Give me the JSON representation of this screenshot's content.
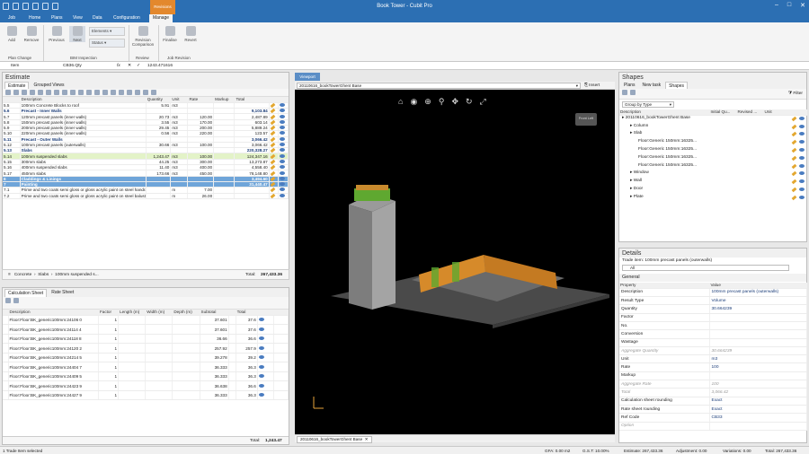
{
  "window": {
    "title": "Book Tower - Cubit Pro",
    "context_tab": "Revisions"
  },
  "menu": [
    "Job",
    "Home",
    "Plans",
    "View",
    "Data",
    "Configuration",
    "Manage"
  ],
  "ribbon": {
    "buttons": [
      {
        "label": "Add",
        "id": "add"
      },
      {
        "label": "Remove",
        "id": "remove"
      },
      {
        "label": "Previous",
        "id": "previous"
      },
      {
        "label": "Next",
        "id": "next"
      },
      {
        "label": "Revision Comparison",
        "id": "revcomp"
      },
      {
        "label": "Finalise",
        "id": "finalise"
      },
      {
        "label": "Revert",
        "id": "revert"
      }
    ],
    "small": {
      "elements": "Elements",
      "status": "Status"
    },
    "groups": [
      "Plan Change",
      "BIM Inspection",
      "Review",
      "Job Revision"
    ]
  },
  "formula_bar": {
    "item": "Item",
    "code": "CB36.Qty",
    "fx": "fx",
    "value": "1243.471616"
  },
  "estimate": {
    "title": "Estimate",
    "tabs": [
      "Estimate",
      "Grouped Views"
    ],
    "columns": [
      "Description",
      "Quantity",
      "Unit",
      "Rate",
      "Markup",
      "Total"
    ],
    "rows": [
      {
        "no": "5.5",
        "desc": "100mm Concrete Blocks to roof",
        "qty": "5.91",
        "unit": "m3",
        "rate": "",
        "total": "",
        "style": ""
      },
      {
        "no": "5.6",
        "desc": "Precast - Inner Walls",
        "qty": "",
        "unit": "",
        "rate": "",
        "total": "9,103.84",
        "style": "bold"
      },
      {
        "no": "5.7",
        "desc": "120mm precast panels (inner walls)",
        "qty": "20.73",
        "unit": "m3",
        "rate": "120.00",
        "total": "2,487.89",
        "style": ""
      },
      {
        "no": "5.8",
        "desc": "150mm precast panels (inner walls)",
        "qty": "3.55",
        "unit": "m3",
        "rate": "170.00",
        "total": "603.14",
        "style": ""
      },
      {
        "no": "5.9",
        "desc": "200mm precast panels (inner walls)",
        "qty": "29.45",
        "unit": "m3",
        "rate": "200.00",
        "total": "5,889.24",
        "style": ""
      },
      {
        "no": "5.10",
        "desc": "220mm precast panels (inner walls)",
        "qty": "0.56",
        "unit": "m3",
        "rate": "220.00",
        "total": "123.57",
        "style": ""
      },
      {
        "no": "5.11",
        "desc": "Precast - Outer Walls",
        "qty": "",
        "unit": "",
        "rate": "",
        "total": "3,066.42",
        "style": "bold"
      },
      {
        "no": "5.12",
        "desc": "100mm precast panels (outerwalls)",
        "qty": "30.66",
        "unit": "m3",
        "rate": "100.00",
        "total": "3,066.42",
        "style": ""
      },
      {
        "no": "5.13",
        "desc": "Slabs",
        "qty": "",
        "unit": "",
        "rate": "",
        "total": "220,328.27",
        "style": "bold"
      },
      {
        "no": "5.14",
        "desc": "100mm suspended slabs",
        "qty": "1,243.47",
        "unit": "m3",
        "rate": "100.00",
        "total": "124,347.16",
        "style": "hl"
      },
      {
        "no": "5.15",
        "desc": "300mm slabs",
        "qty": "44.25",
        "unit": "m3",
        "rate": "300.00",
        "total": "13,273.87",
        "style": ""
      },
      {
        "no": "5.16",
        "desc": "400mm suspended slabs",
        "qty": "11.40",
        "unit": "m3",
        "rate": "400.00",
        "total": "4,558.40",
        "style": ""
      },
      {
        "no": "5.17",
        "desc": "450mm slabs",
        "qty": "173.66",
        "unit": "m3",
        "rate": "450.00",
        "total": "78,148.80",
        "style": ""
      },
      {
        "no": "6",
        "desc": "Claddings & Linings",
        "qty": "",
        "unit": "",
        "rate": "",
        "total": "3,494.60",
        "style": "section"
      },
      {
        "no": "7",
        "desc": "Painting",
        "qty": "",
        "unit": "",
        "rate": "",
        "total": "31,440.47",
        "style": "section"
      },
      {
        "no": "7.1",
        "desc": "Prime and two coats semi gloss or gloss acrylic paint on steel handrail to fire access stair",
        "qty": "",
        "unit": "m",
        "rate": "7.00",
        "total": "",
        "style": ""
      },
      {
        "no": "7.2",
        "desc": "Prime and two coats semi gloss or gloss acrylic paint on steel balustrade 1000mm high to",
        "qty": "",
        "unit": "m",
        "rate": "26.00",
        "total": "",
        "style": ""
      }
    ],
    "breadcrumb": [
      "Concrete",
      "Slabs",
      "100mm suspended s..."
    ],
    "total_label": "Total:",
    "total_value": "267,433.36"
  },
  "calc": {
    "tabs": [
      "Calculation Sheet",
      "Rate Sheet"
    ],
    "columns": [
      "Description",
      "Factor",
      "Length (m)",
      "Width (m)",
      "Depth (m)",
      "Subtotal",
      "Total"
    ],
    "rows": [
      {
        "desc": "Floor:Floor:BK_generic100mm:24106 0",
        "factor": "1",
        "sub": "37.601",
        "total": "37.6"
      },
      {
        "desc": "Floor:Floor:BK_generic100mm:24114 4",
        "factor": "1",
        "sub": "37.601",
        "total": "37.6"
      },
      {
        "desc": "Floor:Floor:BK_generic100mm:24118 8",
        "factor": "1",
        "sub": "36.66",
        "total": "36.6"
      },
      {
        "desc": "Floor:Floor:BK_generic100mm:24120 2",
        "factor": "1",
        "sub": "257.92",
        "total": "257.9"
      },
      {
        "desc": "Floor:Floor:BK_generic100mm:24214 5",
        "factor": "1",
        "sub": "39.278",
        "total": "39.2"
      },
      {
        "desc": "Floor:Floor:BK_generic100mm:24404 7",
        "factor": "1",
        "sub": "36.333",
        "total": "36.3"
      },
      {
        "desc": "Floor:Floor:BK_generic100mm:24409 5",
        "factor": "1",
        "sub": "36.333",
        "total": "36.3"
      },
      {
        "desc": "Floor:Floor:BK_generic100mm:24423 9",
        "factor": "1",
        "sub": "36.638",
        "total": "36.6"
      },
      {
        "desc": "Floor:Floor:BK_generic100mm:24427 9",
        "factor": "1",
        "sub": "36.333",
        "total": "36.3"
      }
    ],
    "total_label": "Total:",
    "total_value": "1,243.47"
  },
  "viewer": {
    "tab": "Viewport",
    "file": "20110616_bookTowerGhent Base",
    "insert": "Insert",
    "bottom_tab": "20110616_bookTowerGhent Base",
    "cube_label": "Front Left"
  },
  "shapes": {
    "title": "Shapes",
    "tabs": [
      "Plans",
      "New task",
      "Shapes"
    ],
    "filter": "Filter",
    "group_by": "Group by Type",
    "columns": [
      "Description",
      "Initial Qu...",
      "Revised ...",
      "Unit"
    ],
    "tree": [
      {
        "label": "20110616_bookTowerGhent Base",
        "indent": 0
      },
      {
        "label": "Column",
        "indent": 1
      },
      {
        "label": "Slab",
        "indent": 1
      },
      {
        "label": "Floor:Generic 150mm:16325...",
        "indent": 2
      },
      {
        "label": "Floor:Generic 150mm:16325...",
        "indent": 2
      },
      {
        "label": "Floor:Generic 150mm:16325...",
        "indent": 2
      },
      {
        "label": "Floor:Generic 150mm:16325...",
        "indent": 2
      },
      {
        "label": "Window",
        "indent": 1
      },
      {
        "label": "Wall",
        "indent": 1
      },
      {
        "label": "Door",
        "indent": 1
      },
      {
        "label": "Plate",
        "indent": 1
      }
    ]
  },
  "details": {
    "title": "Details",
    "trade_item": "Trade item: 100mm precast panels (outerwalls)",
    "all": "All",
    "section": "General",
    "columns": [
      "Property",
      "Value"
    ],
    "props": [
      {
        "k": "Description",
        "v": "100mm precast panels (outerwalls)",
        "muted": false
      },
      {
        "k": "Result Type",
        "v": "Volume",
        "muted": false
      },
      {
        "k": "Quantity",
        "v": "30.664239",
        "muted": false
      },
      {
        "k": "Factor",
        "v": "",
        "muted": false
      },
      {
        "k": "No.",
        "v": "",
        "muted": false
      },
      {
        "k": "Conversion",
        "v": "",
        "muted": false
      },
      {
        "k": "Wastage",
        "v": "",
        "muted": false
      },
      {
        "k": "Aggregate Quantity",
        "v": "30.664239",
        "muted": true
      },
      {
        "k": "Unit",
        "v": "m3",
        "muted": false
      },
      {
        "k": "Rate",
        "v": "100",
        "muted": false
      },
      {
        "k": "Markup",
        "v": "",
        "muted": false
      },
      {
        "k": "Aggregate Rate",
        "v": "100",
        "muted": true
      },
      {
        "k": "Total",
        "v": "3,066.42",
        "muted": true
      },
      {
        "k": "Calculation sheet rounding",
        "v": "Exact",
        "muted": false
      },
      {
        "k": "Rate sheet rounding",
        "v": "Exact",
        "muted": false
      },
      {
        "k": "Ref Code",
        "v": "CB33",
        "muted": false
      },
      {
        "k": "Option",
        "v": "",
        "muted": true
      }
    ]
  },
  "statusbar": {
    "left": "1 Trade Item selected",
    "gfa": "GFA: 0.00 m2",
    "gst": "G.S.T: 10.00%",
    "estimate": "Estimate: 267,433.36",
    "adjustment": "Adjustment: 0.00",
    "variations": "Variations: 0.00",
    "total": "Total: 267,433.36"
  },
  "colors": {
    "accent": "#2c6fb3",
    "context": "#e3882d",
    "section": "#6fa5d9"
  }
}
